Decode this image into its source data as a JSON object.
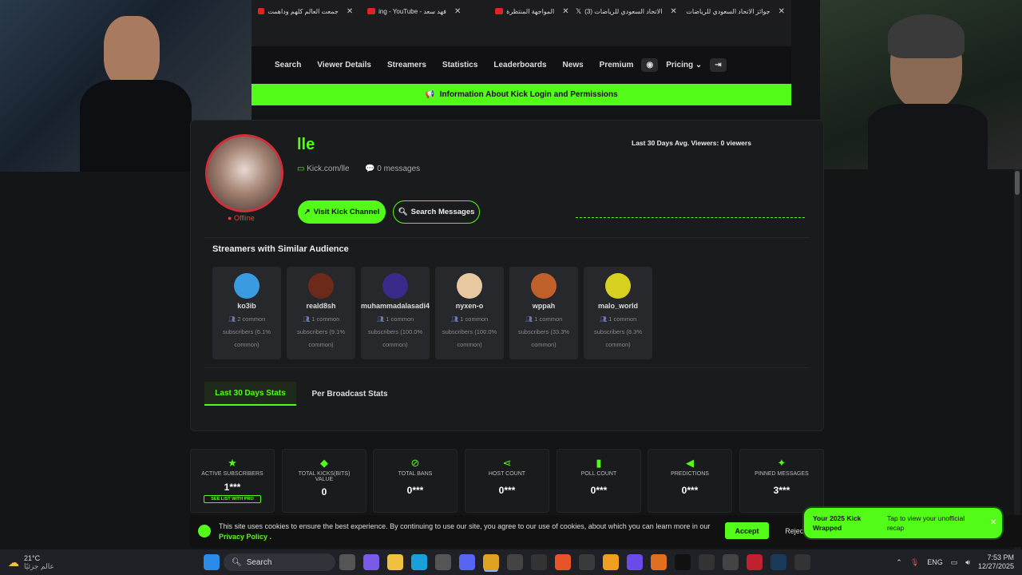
{
  "browser_tabs": [
    {
      "label": "جمعت العالم كلهم وداهمت",
      "fav_color": "#e02424"
    },
    {
      "label": "ing - YouTube - فهد سعد",
      "fav_color": "#e02424"
    },
    {
      "label": "المواجهة المنتظرة",
      "fav_color": "#e02424"
    },
    {
      "label": "(3) الاتحاد السعودي للرياضات",
      "fav_color": "#ffffff"
    },
    {
      "label": "جوائز الاتحاد السعودي للرياضات",
      "fav_color": "#f5a623"
    }
  ],
  "nav": {
    "items": [
      "Search",
      "Viewer Details",
      "Streamers",
      "Statistics",
      "Leaderboards",
      "News",
      "Premium"
    ],
    "pricing": "Pricing"
  },
  "banner": {
    "text": "Information About Kick Login and Permissions"
  },
  "profile": {
    "name": "lle",
    "url": "Kick.com/lle",
    "messages": "0 messages",
    "status": "Offline",
    "avg_viewers": "Last 30 Days Avg. Viewers: 0 viewers",
    "visit_button": "Visit Kick Channel",
    "search_button": "Search Messages"
  },
  "similar": {
    "title": "Streamers with Similar Audience",
    "streamers": [
      {
        "name": "ko3ib",
        "c1": "2 common",
        "c2": "subscribers (6.1%",
        "c3": "common)",
        "color": "#3b9be0"
      },
      {
        "name": "reald8sh",
        "c1": "1 common",
        "c2": "subscribers (9.1%",
        "c3": "common)",
        "color": "#6b2a1a"
      },
      {
        "name": "muhammadalasadi4",
        "c1": "1 common",
        "c2": "subscribers (100.0%",
        "c3": "common)",
        "color": "#3a2a8a"
      },
      {
        "name": "nyxen-o",
        "c1": "1 common",
        "c2": "subscribers (100.0%",
        "c3": "common)",
        "color": "#e8c8a0"
      },
      {
        "name": "wppah",
        "c1": "1 common",
        "c2": "subscribers (33.3%",
        "c3": "common)",
        "color": "#c0602a"
      },
      {
        "name": "malo_world",
        "c1": "1 common",
        "c2": "subscribers (8.3%",
        "c3": "common)",
        "color": "#d8d020"
      }
    ]
  },
  "tabs": {
    "active": "Last 30 Days Stats",
    "other": "Per Broadcast Stats"
  },
  "stats": [
    {
      "icon": "★",
      "label": "Active Subscribers",
      "value": "1***",
      "extra": "SEE LIST WITH PRO"
    },
    {
      "icon": "◆",
      "label": "Total Kicks(Bits) Value",
      "value": "0",
      "extra": ""
    },
    {
      "icon": "⊘",
      "label": "Total Bans",
      "value": "0***",
      "extra": ""
    },
    {
      "icon": "⋖",
      "label": "Host Count",
      "value": "0***",
      "extra": ""
    },
    {
      "icon": "▮",
      "label": "Poll Count",
      "value": "0***",
      "extra": ""
    },
    {
      "icon": "◀",
      "label": "Predictions",
      "value": "0***",
      "extra": ""
    },
    {
      "icon": "✦",
      "label": "Pinned Messages",
      "value": "3***",
      "extra": ""
    }
  ],
  "cookie": {
    "text": "This site uses cookies to ensure the best experience. By continuing to use our site, you agree to our use of cookies, about which you can learn more in our",
    "link": "Privacy Policy .",
    "accept": "Accept",
    "reject": "Reject"
  },
  "wrapped": {
    "title": "Your 2025 Kick Wrapped",
    "subtitle": "Tap to view your unofficial recap"
  },
  "taskbar": {
    "weather_temp": "21°C",
    "weather_desc": "عالم جزئيًا",
    "search": "Search",
    "lang": "ENG",
    "time": "7:53 PM",
    "date": "12/27/2025"
  }
}
